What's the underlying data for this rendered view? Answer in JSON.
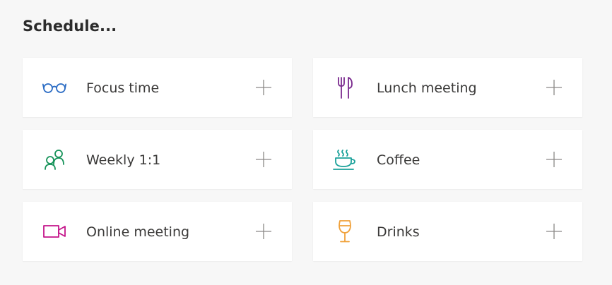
{
  "header": {
    "title": "Schedule..."
  },
  "cards": [
    {
      "label": "Focus time",
      "icon": "glasses-icon",
      "color": "#2b6cc4"
    },
    {
      "label": "Lunch meeting",
      "icon": "fork-knife-icon",
      "color": "#7a2a8e"
    },
    {
      "label": "Weekly 1:1",
      "icon": "people-icon",
      "color": "#17935a"
    },
    {
      "label": "Coffee",
      "icon": "coffee-cup-icon",
      "color": "#1aa19a"
    },
    {
      "label": "Online meeting",
      "icon": "video-camera-icon",
      "color": "#c4148a"
    },
    {
      "label": "Drinks",
      "icon": "wine-glass-icon",
      "color": "#f0a13a"
    }
  ],
  "add_icon": "plus-icon"
}
